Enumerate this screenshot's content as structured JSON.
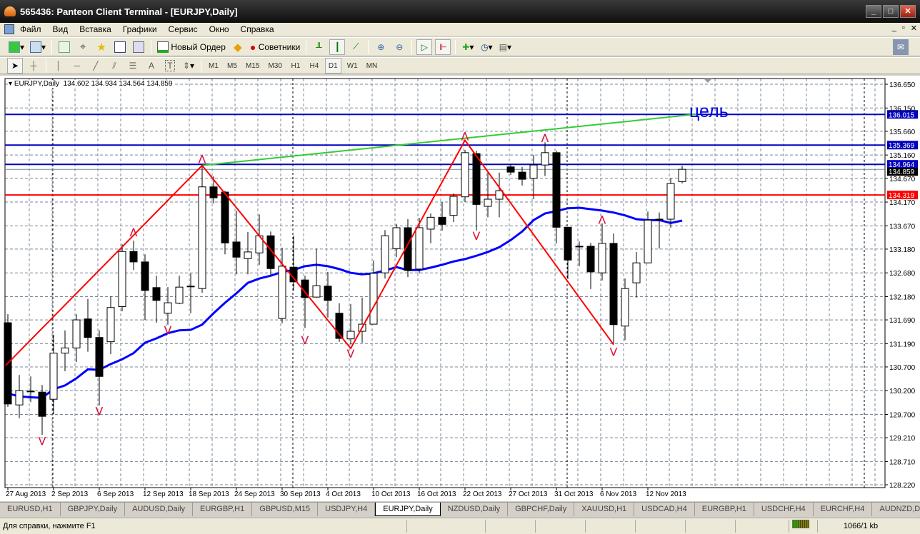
{
  "window": {
    "title": "565436: Panteon Client Terminal - [EURJPY,Daily]",
    "min": "_",
    "max": "□",
    "close": "✕"
  },
  "menu": [
    "Файл",
    "Вид",
    "Вставка",
    "Графики",
    "Сервис",
    "Окно",
    "Справка"
  ],
  "toolbar": {
    "new_order": "Новый Ордер",
    "advisors": "Советники"
  },
  "timeframes": [
    "M1",
    "M5",
    "M15",
    "M30",
    "H1",
    "H4",
    "D1",
    "W1",
    "MN"
  ],
  "active_timeframe": "D1",
  "drawing_tools": {
    "text": "A",
    "textlabel": "T"
  },
  "chart_header": {
    "symbol": "EURJPY,Daily",
    "open": "134.602",
    "high": "134.934",
    "low": "134.564",
    "close": "134.859"
  },
  "annotation": "цель",
  "colors": {
    "bull": "#ffffff",
    "bear": "#000000",
    "ma": "#0000ff",
    "zigzag": "#ff0000",
    "trend": "#33cc33",
    "level_blue": "#0000c0",
    "level_red": "#ff0000"
  },
  "chart_data": {
    "type": "candlestick",
    "symbol": "EURJPY",
    "timeframe": "Daily",
    "ylim": [
      128.22,
      136.65
    ],
    "y_ticks": [
      "136.650",
      "136.150",
      "135.660",
      "135.160",
      "134.670",
      "134.170",
      "133.670",
      "133.180",
      "132.680",
      "132.180",
      "131.690",
      "131.190",
      "130.700",
      "130.200",
      "129.700",
      "129.210",
      "128.710",
      "128.220"
    ],
    "x_labels": [
      {
        "i": 0,
        "t": "27 Aug 2013"
      },
      {
        "i": 4,
        "t": "2 Sep 2013"
      },
      {
        "i": 8,
        "t": "6 Sep 2013"
      },
      {
        "i": 12,
        "t": "12 Sep 2013"
      },
      {
        "i": 16,
        "t": "18 Sep 2013"
      },
      {
        "i": 20,
        "t": "24 Sep 2013"
      },
      {
        "i": 24,
        "t": "30 Sep 2013"
      },
      {
        "i": 28,
        "t": "4 Oct 2013"
      },
      {
        "i": 32,
        "t": "10 Oct 2013"
      },
      {
        "i": 36,
        "t": "16 Oct 2013"
      },
      {
        "i": 40,
        "t": "22 Oct 2013"
      },
      {
        "i": 44,
        "t": "27 Oct 2013"
      },
      {
        "i": 48,
        "t": "31 Oct 2013"
      },
      {
        "i": 52,
        "t": "6 Nov 2013"
      },
      {
        "i": 56,
        "t": "12 Nov 2013"
      }
    ],
    "ohlc": [
      [
        131.63,
        131.81,
        129.86,
        129.92
      ],
      [
        129.9,
        130.53,
        129.62,
        130.2
      ],
      [
        130.19,
        130.5,
        129.96,
        130.19
      ],
      [
        130.17,
        130.32,
        129.27,
        129.66
      ],
      [
        130.02,
        131.38,
        129.71,
        130.99
      ],
      [
        130.99,
        131.47,
        130.61,
        131.1
      ],
      [
        131.1,
        131.81,
        130.8,
        131.69
      ],
      [
        131.71,
        132.13,
        131.02,
        131.32
      ],
      [
        131.32,
        131.47,
        129.89,
        130.5
      ],
      [
        131.23,
        132.19,
        130.97,
        131.95
      ],
      [
        131.97,
        133.28,
        131.87,
        133.13
      ],
      [
        133.13,
        133.36,
        132.74,
        132.91
      ],
      [
        132.91,
        133.07,
        131.69,
        132.31
      ],
      [
        132.37,
        132.62,
        131.63,
        132.1
      ],
      [
        131.83,
        132.38,
        131.59,
        132.05
      ],
      [
        132.04,
        132.62,
        132.02,
        132.38
      ],
      [
        132.4,
        132.67,
        131.83,
        132.4
      ],
      [
        132.35,
        134.94,
        132.26,
        134.49
      ],
      [
        134.49,
        134.71,
        134.14,
        134.26
      ],
      [
        134.38,
        134.41,
        133.07,
        133.31
      ],
      [
        133.33,
        133.99,
        132.65,
        133.01
      ],
      [
        132.98,
        133.54,
        132.65,
        133.12
      ],
      [
        133.1,
        133.91,
        132.85,
        133.46
      ],
      [
        133.46,
        133.55,
        132.64,
        132.77
      ],
      [
        131.72,
        133.21,
        131.62,
        132.82
      ],
      [
        132.8,
        133.46,
        132.31,
        132.49
      ],
      [
        132.53,
        132.62,
        131.52,
        132.16
      ],
      [
        132.17,
        133.19,
        132.16,
        132.41
      ],
      [
        132.4,
        132.7,
        131.74,
        132.1
      ],
      [
        131.83,
        132.04,
        131.23,
        131.3
      ],
      [
        131.29,
        132.02,
        131.17,
        131.45
      ],
      [
        131.45,
        132.16,
        131.21,
        131.6
      ],
      [
        131.6,
        132.94,
        131.6,
        132.67
      ],
      [
        132.68,
        133.58,
        132.56,
        133.46
      ],
      [
        133.19,
        133.71,
        133.01,
        133.63
      ],
      [
        133.63,
        133.81,
        132.59,
        132.73
      ],
      [
        132.76,
        133.84,
        132.67,
        133.63
      ],
      [
        133.6,
        133.93,
        133.3,
        133.85
      ],
      [
        133.85,
        134.17,
        133.57,
        133.7
      ],
      [
        133.89,
        134.35,
        133.75,
        134.29
      ],
      [
        134.28,
        135.27,
        134.17,
        135.21
      ],
      [
        135.19,
        135.25,
        133.57,
        134.12
      ],
      [
        134.08,
        134.79,
        133.85,
        134.23
      ],
      [
        134.23,
        134.79,
        133.85,
        134.41
      ],
      [
        134.91,
        134.97,
        134.74,
        134.8
      ],
      [
        134.8,
        134.91,
        134.52,
        134.65
      ],
      [
        134.67,
        135.16,
        134.23,
        134.95
      ],
      [
        134.95,
        135.43,
        134.72,
        135.21
      ],
      [
        135.21,
        135.25,
        133.3,
        133.64
      ],
      [
        133.64,
        133.64,
        132.55,
        132.95
      ],
      [
        133.24,
        133.34,
        132.82,
        133.24
      ],
      [
        133.24,
        133.31,
        132.34,
        132.7
      ],
      [
        132.68,
        133.72,
        132.52,
        133.3
      ],
      [
        133.3,
        133.51,
        131.17,
        131.59
      ],
      [
        131.56,
        132.56,
        131.26,
        132.35
      ],
      [
        132.47,
        133.12,
        132.16,
        132.89
      ],
      [
        132.89,
        133.97,
        132.89,
        133.79
      ],
      [
        133.81,
        133.95,
        133.19,
        133.81
      ],
      [
        133.81,
        134.68,
        133.63,
        134.56
      ],
      [
        134.602,
        134.934,
        134.564,
        134.859
      ]
    ],
    "ma": [
      130.14,
      130.08,
      130.06,
      130.05,
      130.23,
      130.31,
      130.46,
      130.65,
      130.64,
      130.76,
      130.86,
      130.99,
      131.21,
      131.3,
      131.41,
      131.47,
      131.48,
      131.59,
      131.83,
      132.05,
      132.25,
      132.47,
      132.56,
      132.62,
      132.7,
      132.74,
      132.82,
      132.85,
      132.82,
      132.76,
      132.68,
      132.65,
      132.67,
      132.73,
      132.8,
      132.74,
      132.74,
      132.79,
      132.85,
      132.92,
      132.97,
      133.04,
      133.12,
      133.22,
      133.37,
      133.55,
      133.79,
      133.93,
      133.98,
      134.04,
      134.05,
      134.02,
      133.99,
      133.95,
      133.89,
      133.81,
      133.79,
      133.79,
      133.73,
      133.78
    ],
    "zigzag": [
      [
        -0.2,
        130.73
      ],
      [
        17,
        134.94
      ],
      [
        30,
        131.09
      ],
      [
        40,
        135.47
      ],
      [
        53,
        131.17
      ]
    ],
    "trendline": [
      [
        17,
        134.94
      ],
      [
        60.3,
        136.02
      ]
    ],
    "fractals_up": [
      [
        11,
        133.55
      ],
      [
        17,
        135.09
      ],
      [
        40,
        135.57
      ],
      [
        47,
        135.53
      ],
      [
        52,
        133.81
      ]
    ],
    "fractals_down": [
      [
        3,
        129.15
      ],
      [
        8,
        129.78
      ],
      [
        14,
        131.49
      ],
      [
        26,
        131.28
      ],
      [
        30,
        130.99
      ],
      [
        41,
        133.47
      ],
      [
        53,
        131.03
      ]
    ],
    "levels": [
      {
        "price": 136.015,
        "label": "136.015",
        "color": "#0000c0"
      },
      {
        "price": 135.369,
        "label": "135.369",
        "color": "#0000c0"
      },
      {
        "price": 134.964,
        "label": "134.964",
        "color": "#0000c0"
      },
      {
        "price": 134.319,
        "label": "134.319",
        "color": "#ff0000"
      }
    ],
    "bid_line": {
      "price": 134.859,
      "label": "134.859"
    },
    "period_separators": [
      4,
      25,
      49,
      75
    ]
  },
  "tabs": [
    "EURUSD,H1",
    "GBPJPY,Daily",
    "AUDUSD,Daily",
    "EURGBP,H1",
    "GBPUSD,M15",
    "USDJPY,H4",
    "EURJPY,Daily",
    "NZDUSD,Daily",
    "GBPCHF,Daily",
    "XAUUSD,H1",
    "USDCAD,H4",
    "EURGBP,H1",
    "USDCHF,H4",
    "EURCHF,H4",
    "AUDNZD,Daily"
  ],
  "active_tab": "EURJPY,Daily",
  "status": {
    "help": "Для справки, нажмите F1",
    "traffic": "1066/1 kb"
  }
}
